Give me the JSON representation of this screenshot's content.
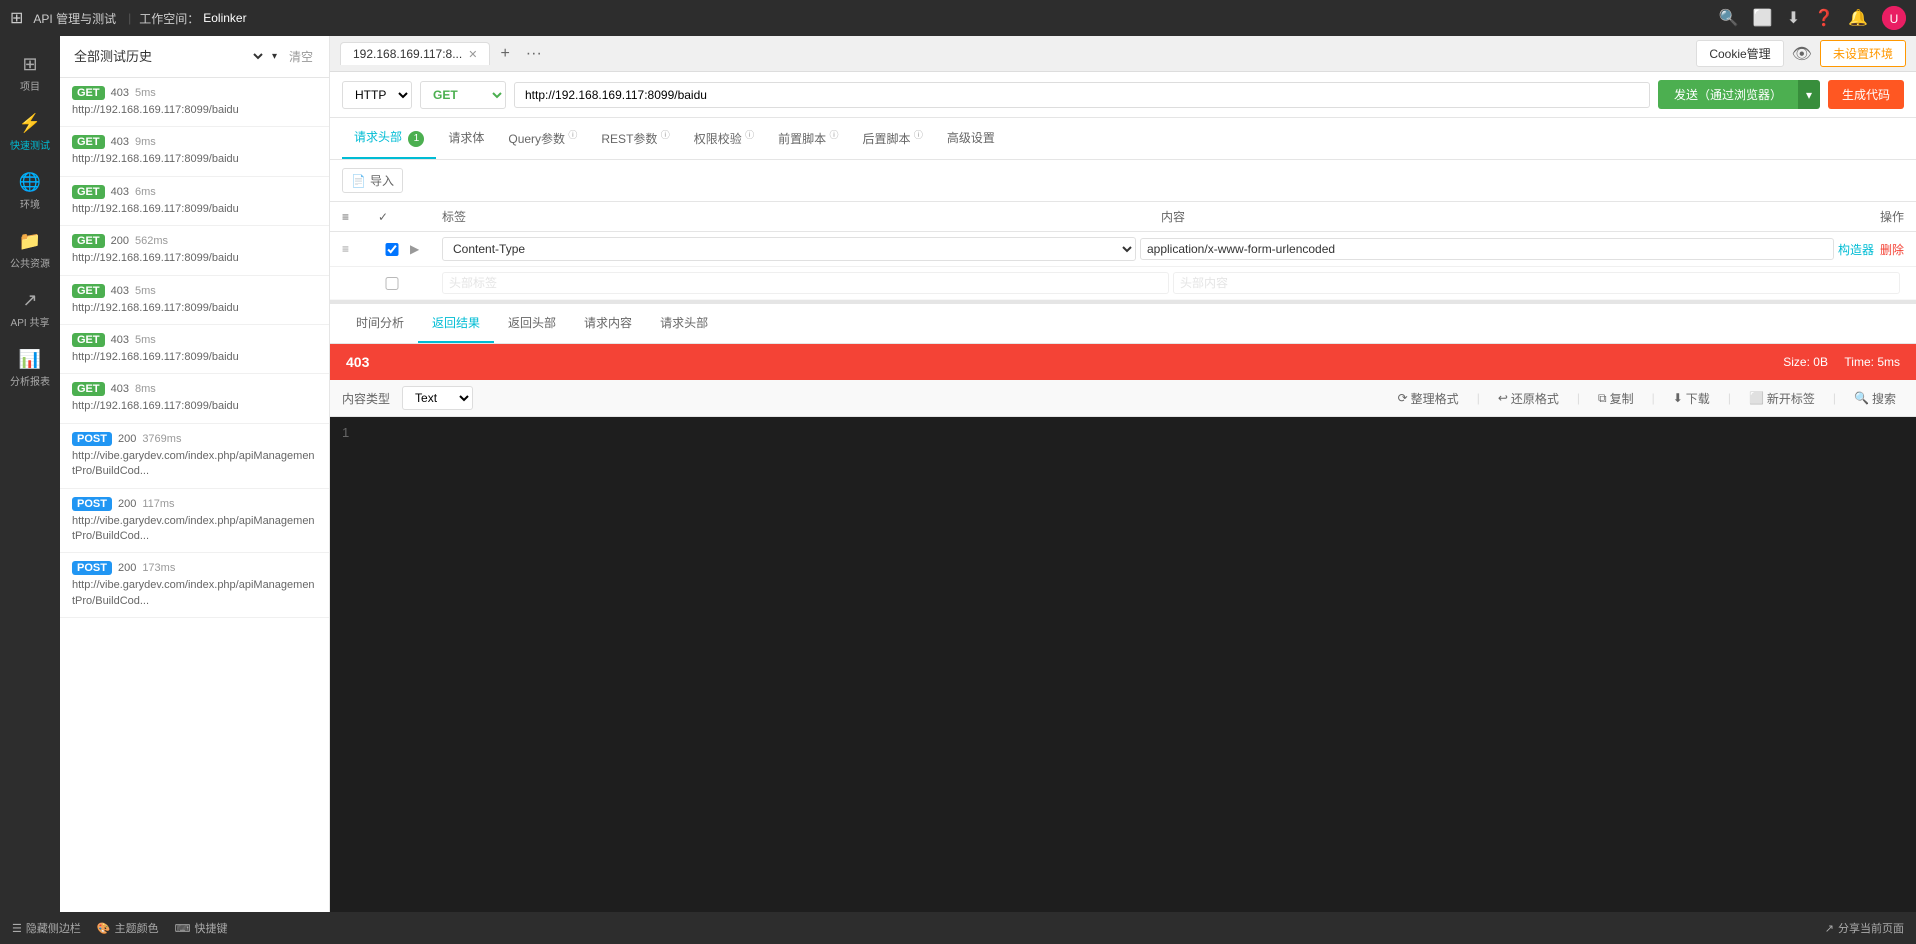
{
  "header": {
    "app_icon": "⊞",
    "title": "API 管理与测试",
    "workspace_label": "工作空间：",
    "workspace_name": "Eolinker",
    "icons": [
      "🔍",
      "⬜",
      "⬇",
      "❓",
      "🔔"
    ],
    "cookie_btn": "Cookie管理",
    "env_btn": "未设置环境"
  },
  "nav": {
    "items": [
      {
        "id": "project",
        "icon": "⊞",
        "label": "项目"
      },
      {
        "id": "quick-test",
        "icon": "⚡",
        "label": "快速测试"
      },
      {
        "id": "env",
        "icon": "🌐",
        "label": "环境"
      },
      {
        "id": "public-resource",
        "icon": "📁",
        "label": "公共资源"
      },
      {
        "id": "api-share",
        "icon": "↗",
        "label": "API 共享"
      },
      {
        "id": "analytics",
        "icon": "📊",
        "label": "分析报表"
      }
    ]
  },
  "history": {
    "select_placeholder": "全部测试历史",
    "clear_label": "清空",
    "items": [
      {
        "method": "GET",
        "method_class": "method-get",
        "status": "403",
        "duration": "5ms",
        "url": "http://192.168.169.117:8099/baidu"
      },
      {
        "method": "GET",
        "method_class": "method-get",
        "status": "403",
        "duration": "9ms",
        "url": "http://192.168.169.117:8099/baidu"
      },
      {
        "method": "GET",
        "method_class": "method-get",
        "status": "403",
        "duration": "6ms",
        "url": "http://192.168.169.117:8099/baidu"
      },
      {
        "method": "GET",
        "method_class": "method-get",
        "status": "200",
        "duration": "562ms",
        "url": "http://192.168.169.117:8099/baidu"
      },
      {
        "method": "GET",
        "method_class": "method-get",
        "status": "403",
        "duration": "5ms",
        "url": "http://192.168.169.117:8099/baidu"
      },
      {
        "method": "GET",
        "method_class": "method-get",
        "status": "403",
        "duration": "5ms",
        "url": "http://192.168.169.117:8099/baidu"
      },
      {
        "method": "GET",
        "method_class": "method-get",
        "status": "403",
        "duration": "8ms",
        "url": "http://192.168.169.117:8099/baidu"
      },
      {
        "method": "POST",
        "method_class": "method-post",
        "status": "200",
        "duration": "3769ms",
        "url": "http://vibe.garydev.com/index.php/apiManagementPro/BuildCod..."
      },
      {
        "method": "POST",
        "method_class": "method-post",
        "status": "200",
        "duration": "117ms",
        "url": "http://vibe.garydev.com/index.php/apiManagementPro/BuildCod..."
      },
      {
        "method": "POST",
        "method_class": "method-post",
        "status": "200",
        "duration": "173ms",
        "url": "http://vibe.garydev.com/index.php/apiManagementPro/BuildCod..."
      }
    ]
  },
  "tab_bar": {
    "tabs": [
      {
        "id": "tab1",
        "label": "192.168.169.117:8..."
      }
    ],
    "add_label": "+",
    "more_label": "···"
  },
  "request": {
    "protocol": "HTTP",
    "method": "GET",
    "url": "http://192.168.169.117:8099/baidu",
    "send_label": "发送（通过浏览器）",
    "send_dropdown": "▾",
    "gen_code_label": "生成代码"
  },
  "req_tabs": [
    {
      "id": "req-header",
      "label": "请求头部",
      "badge": "1",
      "active": true
    },
    {
      "id": "req-body",
      "label": "请求体",
      "badge": null
    },
    {
      "id": "query-params",
      "label": "Query参数",
      "badge": null,
      "info": true
    },
    {
      "id": "rest-params",
      "label": "REST参数",
      "badge": null,
      "info": true
    },
    {
      "id": "auth",
      "label": "权限校验",
      "badge": null,
      "info": true
    },
    {
      "id": "pre-script",
      "label": "前置脚本",
      "badge": null,
      "info": true
    },
    {
      "id": "post-script",
      "label": "后置脚本",
      "badge": null,
      "info": true
    },
    {
      "id": "advanced",
      "label": "高级设置"
    }
  ],
  "import_label": "导入",
  "headers_table": {
    "columns": [
      "",
      "",
      "",
      "标签",
      "内容",
      "操作"
    ],
    "rows": [
      {
        "checked": true,
        "key": "Content-Type",
        "value": "application/x-www-form-urlencoded",
        "actions": [
          "构造器",
          "删除"
        ]
      },
      {
        "checked": false,
        "key": "",
        "value": "",
        "key_placeholder": "头部标签",
        "value_placeholder": "头部内容",
        "actions": []
      }
    ]
  },
  "result_tabs": [
    {
      "id": "time-analysis",
      "label": "时间分析"
    },
    {
      "id": "return-result",
      "label": "返回结果",
      "active": true
    },
    {
      "id": "return-headers",
      "label": "返回头部"
    },
    {
      "id": "req-content",
      "label": "请求内容"
    },
    {
      "id": "req-headers",
      "label": "请求头部"
    }
  ],
  "result": {
    "status_code": "403",
    "size_label": "Size:",
    "size_value": "0B",
    "time_label": "Time:",
    "time_value": "5ms"
  },
  "content_toolbar": {
    "type_label": "内容类型",
    "type_value": "Text",
    "actions": [
      "整理格式",
      "还原格式",
      "复制",
      "下载",
      "新开标签",
      "搜索"
    ]
  },
  "code_area": {
    "line_numbers": [
      "1"
    ],
    "content": ""
  },
  "bottom_bar": {
    "items": [
      {
        "icon": "☰",
        "label": "隐藏侧边栏"
      },
      {
        "icon": "🎨",
        "label": "主题颜色"
      },
      {
        "icon": "⌨",
        "label": "快捷键"
      }
    ],
    "share_label": "分享当前页面",
    "share_icon": "↗"
  }
}
